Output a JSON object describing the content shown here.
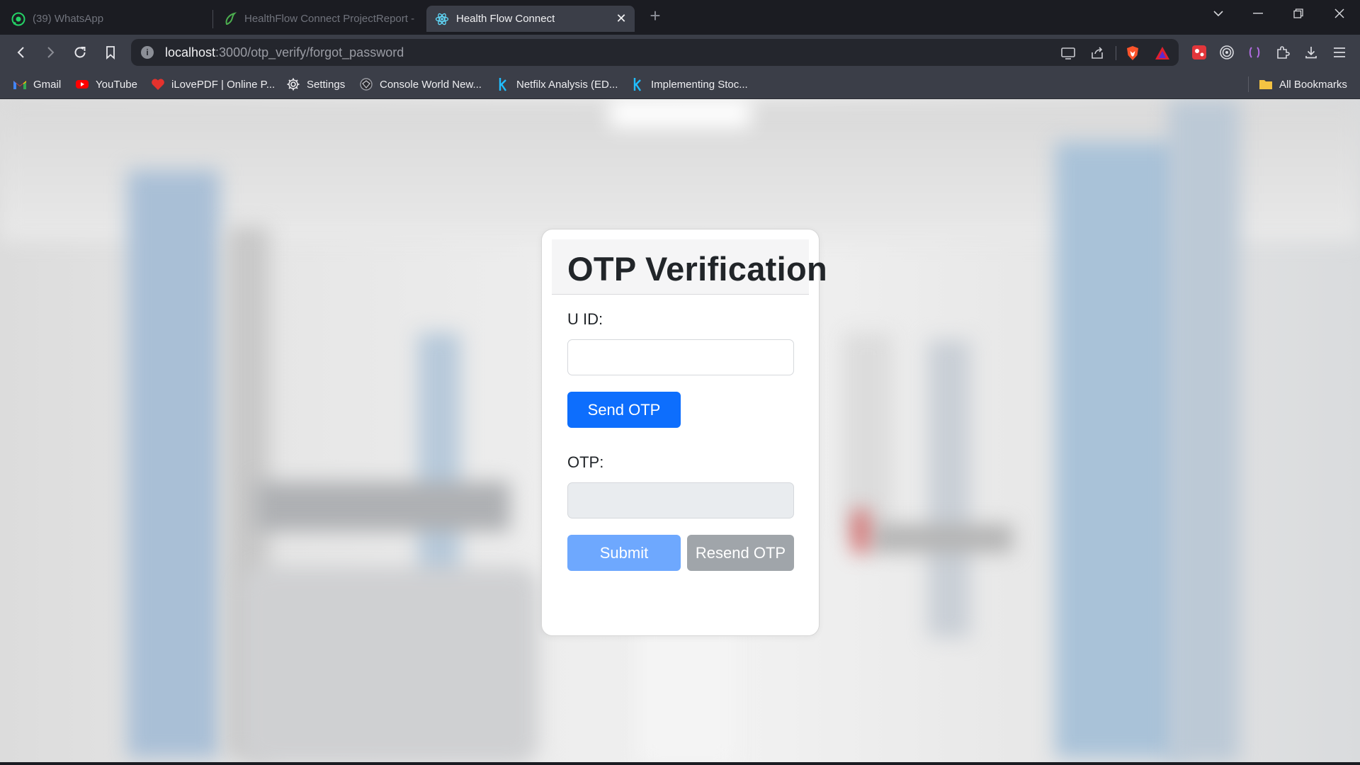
{
  "browser": {
    "tabs": [
      {
        "title": "(39) WhatsApp",
        "icon": "whatsapp-icon",
        "active": false
      },
      {
        "title": "HealthFlow Connect ProjectReport -",
        "icon": "overleaf-icon",
        "active": false
      },
      {
        "title": "Health Flow Connect",
        "icon": "react-icon",
        "active": true
      }
    ],
    "address": {
      "host": "localhost",
      "path": ":3000/otp_verify/forgot_password"
    },
    "bookmarks": [
      {
        "label": "Gmail",
        "icon": "gmail-icon"
      },
      {
        "label": "YouTube",
        "icon": "youtube-icon"
      },
      {
        "label": "iLovePDF | Online P...",
        "icon": "ilovepdf-icon"
      },
      {
        "label": "Settings",
        "icon": "gear-icon"
      },
      {
        "label": "Console World New...",
        "icon": "console-world-icon"
      },
      {
        "label": "Netfilx Analysis (ED...",
        "icon": "kaggle-icon"
      },
      {
        "label": "Implementing Stoc...",
        "icon": "kaggle-icon"
      }
    ],
    "all_bookmarks": "All Bookmarks"
  },
  "form": {
    "title": "OTP Verification",
    "uid_label": "U ID:",
    "uid_value": "",
    "send_otp": "Send OTP",
    "otp_label": "OTP:",
    "otp_value": "",
    "submit": "Submit",
    "resend_otp": "Resend OTP"
  },
  "colors": {
    "primary": "#0d6efd",
    "primary_disabled": "#6ea8fe",
    "secondary_disabled": "#a0a5aa",
    "browser_toolbar": "#3b3e48"
  }
}
